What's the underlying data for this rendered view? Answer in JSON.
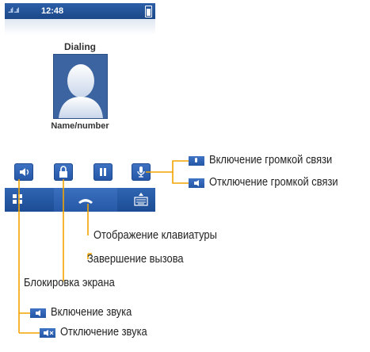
{
  "status": {
    "time": "12:48",
    "signal": "..ıl ..ıl"
  },
  "call": {
    "state": "Dialing",
    "name": "Name/number"
  },
  "icons": {
    "speaker": "speaker-icon",
    "lock": "lock-icon",
    "pause": "pause-icon",
    "mic": "microphone-icon",
    "menu": "menu-icon",
    "end_call": "end-call-icon",
    "keypad": "keypad-icon"
  },
  "callouts": {
    "speaker_on": "Включение громкой связи",
    "speaker_off": "Отключение громкой связи",
    "keypad": "Отображение клавиатуры",
    "end_call": "Завершение вызова",
    "lock": "Блокировка экрана",
    "sound_on": "Включение звука",
    "sound_off": "Отключение звука"
  },
  "colors": {
    "accent": "#2556a6",
    "line": "#f2a400"
  }
}
